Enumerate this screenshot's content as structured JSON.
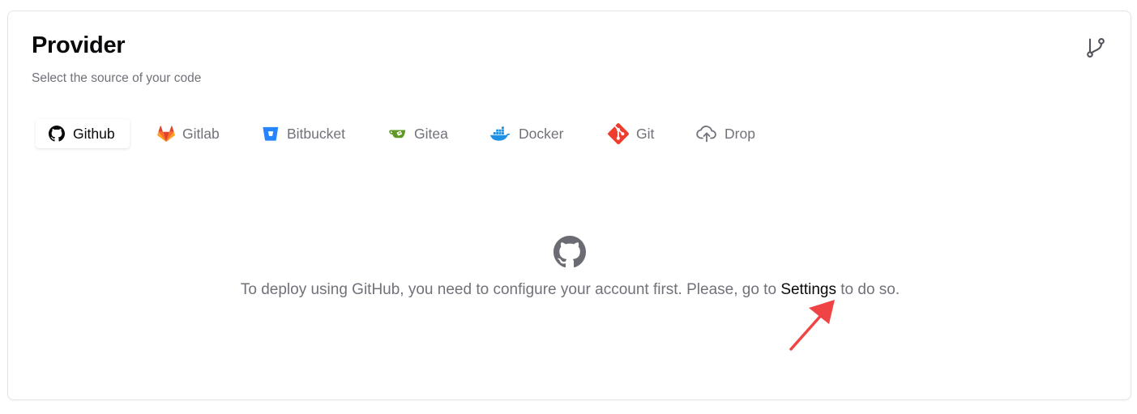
{
  "header": {
    "title": "Provider",
    "subtitle": "Select the source of your code",
    "icon": "git-branch-icon"
  },
  "tabs": [
    {
      "label": "Github",
      "icon": "github-icon",
      "active": true
    },
    {
      "label": "Gitlab",
      "icon": "gitlab-icon",
      "active": false
    },
    {
      "label": "Bitbucket",
      "icon": "bitbucket-icon",
      "active": false
    },
    {
      "label": "Gitea",
      "icon": "gitea-icon",
      "active": false
    },
    {
      "label": "Docker",
      "icon": "docker-icon",
      "active": false
    },
    {
      "label": "Git",
      "icon": "git-icon",
      "active": false
    },
    {
      "label": "Drop",
      "icon": "cloud-upload-icon",
      "active": false
    }
  ],
  "empty_state": {
    "icon": "github-icon",
    "message_before": "To deploy using GitHub, you need to configure your account first. Please, go to ",
    "link_label": "Settings",
    "message_after": " to do so."
  },
  "annotation": {
    "icon": "red-arrow-icon",
    "color": "#f04444"
  },
  "colors": {
    "gitlab": "#e24329",
    "bitbucket": "#2684ff",
    "gitea": "#609926",
    "docker": "#1d91e6",
    "git": "#f03c2e"
  }
}
